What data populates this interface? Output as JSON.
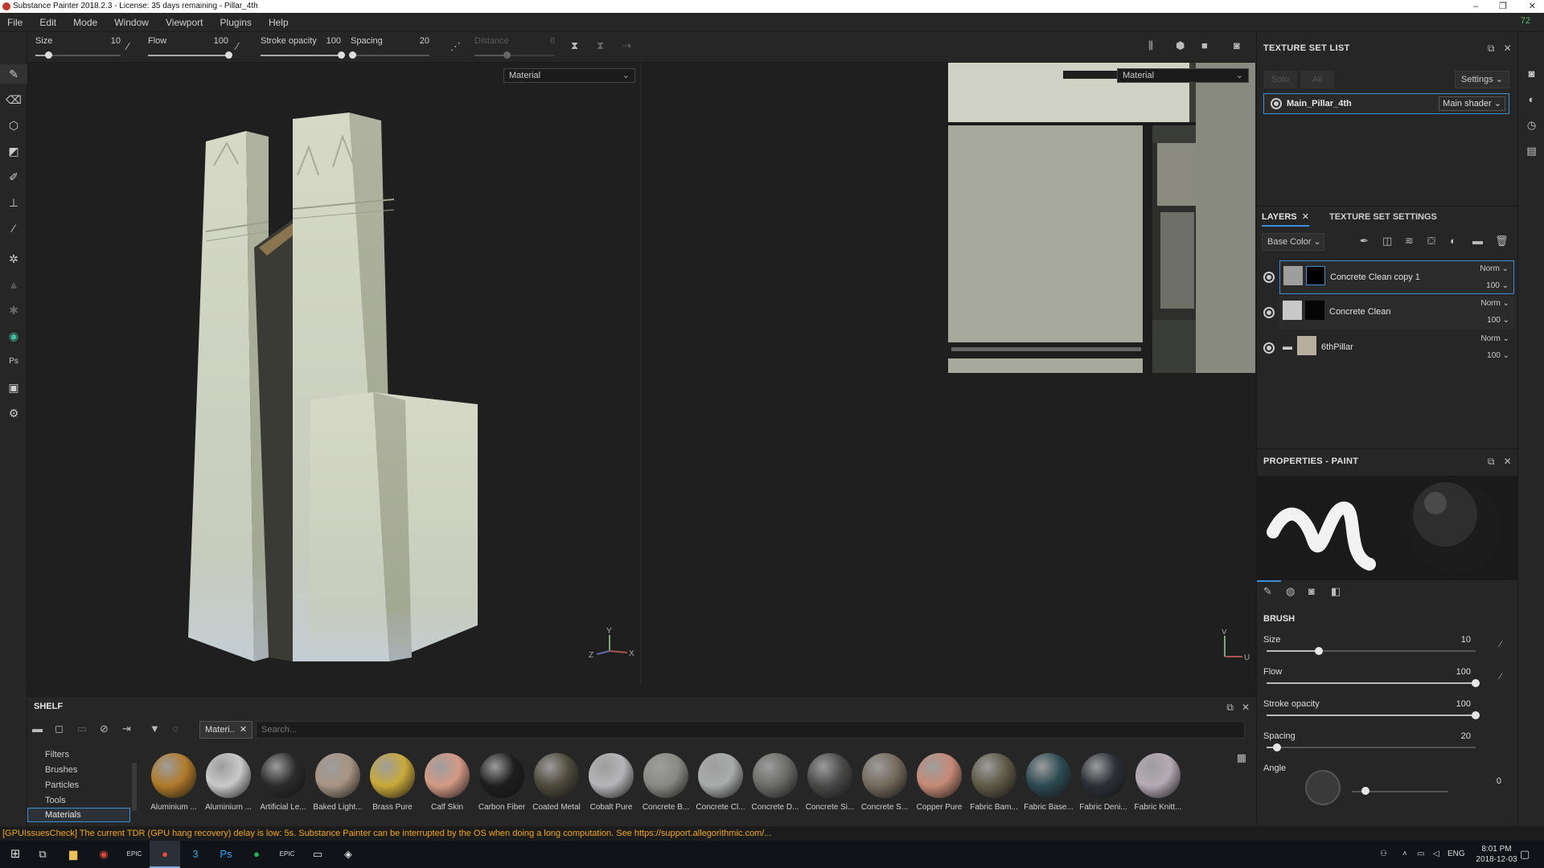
{
  "window": {
    "title": "Substance Painter 2018.2.3 - License: 35 days remaining - Pillar_4th",
    "controls": {
      "minimize": "–",
      "maximize": "❐",
      "close": "✕"
    }
  },
  "menu": {
    "items": [
      "File",
      "Edit",
      "Mode",
      "Window",
      "Viewport",
      "Plugins",
      "Help"
    ],
    "fps": "72"
  },
  "toolbar": {
    "size": {
      "label": "Size",
      "value": "10",
      "fraction": 0.15
    },
    "flow": {
      "label": "Flow",
      "value": "100",
      "fraction": 1.0
    },
    "stroke_opacity": {
      "label": "Stroke opacity",
      "value": "100",
      "fraction": 1.0
    },
    "spacing": {
      "label": "Spacing",
      "value": "20",
      "fraction": 0.02
    },
    "distance": {
      "label": "Distance",
      "value": "8",
      "fraction": 0.4
    }
  },
  "viewport3d": {
    "mode": "Material"
  },
  "viewport2d": {
    "mode": "Material"
  },
  "texture_set_list": {
    "title": "TEXTURE SET LIST",
    "solo_label": "Solo",
    "all_label": "All",
    "settings_label": "Settings",
    "set_name": "Main_Pillar_4th",
    "shader": "Main shader"
  },
  "layers": {
    "tab_layers": "LAYERS",
    "tab_texture_set_settings": "TEXTURE SET SETTINGS",
    "channel": "Base Color",
    "items": [
      {
        "name": "Concrete Clean copy 1",
        "blend": "Norm",
        "opacity": "100"
      },
      {
        "name": "Concrete Clean",
        "blend": "Norm",
        "opacity": "100"
      },
      {
        "name": "6thPillar",
        "blend": "Norm",
        "opacity": "100"
      }
    ]
  },
  "properties": {
    "title": "PROPERTIES - PAINT",
    "section": "BRUSH",
    "size": {
      "label": "Size",
      "value": "10",
      "fraction": 0.25
    },
    "flow": {
      "label": "Flow",
      "value": "100",
      "fraction": 1.0
    },
    "stroke_opacity": {
      "label": "Stroke opacity",
      "value": "100",
      "fraction": 1.0
    },
    "spacing": {
      "label": "Spacing",
      "value": "20",
      "fraction": 0.05
    },
    "angle": {
      "label": "Angle",
      "value": "0"
    }
  },
  "shelf": {
    "title": "SHELF",
    "filter_tag": "Materi..",
    "search_placeholder": "Search...",
    "categories": [
      "Filters",
      "Brushes",
      "Particles",
      "Tools",
      "Materials"
    ],
    "materials": [
      {
        "label": "Aluminium ...",
        "color": "#b07a2a"
      },
      {
        "label": "Aluminium ...",
        "color": "#c9c9c9"
      },
      {
        "label": "Artificial Le...",
        "color": "#2b2b2b"
      },
      {
        "label": "Baked Light...",
        "color": "#a89483"
      },
      {
        "label": "Brass Pure",
        "color": "#c9a93a"
      },
      {
        "label": "Calf Skin",
        "color": "#d49a86"
      },
      {
        "label": "Carbon Fiber",
        "color": "#1e1e1e"
      },
      {
        "label": "Coated Metal",
        "color": "#4d4a3c"
      },
      {
        "label": "Cobalt Pure",
        "color": "#b5b5b8"
      },
      {
        "label": "Concrete B...",
        "color": "#8a8a85"
      },
      {
        "label": "Concrete Cl...",
        "color": "#a9acab"
      },
      {
        "label": "Concrete D...",
        "color": "#6b6b69"
      },
      {
        "label": "Concrete Si...",
        "color": "#4a4a49"
      },
      {
        "label": "Concrete S...",
        "color": "#756a5c"
      },
      {
        "label": "Copper Pure",
        "color": "#c58a76"
      },
      {
        "label": "Fabric Bam...",
        "color": "#5e5a47"
      },
      {
        "label": "Fabric Base...",
        "color": "#2d4a52"
      },
      {
        "label": "Fabric Deni...",
        "color": "#2c3036"
      },
      {
        "label": "Fabric Knitt...",
        "color": "#b6abb4"
      }
    ]
  },
  "status": {
    "message": "[GPUIssuesCheck] The current TDR (GPU hang recovery) delay is low: 5s. Substance Painter can be interrupted by the OS when doing a long computation. See https://support.allegorithmic.com/..."
  },
  "taskbar": {
    "apps": [
      {
        "icon": "file-explorer-icon",
        "glyph": "▆",
        "color": "#e8c15a"
      },
      {
        "icon": "chrome-icon",
        "glyph": "◉",
        "color": "#d94b3b"
      },
      {
        "icon": "epic-games-icon",
        "glyph": "EPIC",
        "color": "#dddddd"
      },
      {
        "icon": "substance-painter-icon",
        "glyph": "●",
        "color": "#e74c3c"
      },
      {
        "icon": "app-3-icon",
        "glyph": "3",
        "color": "#2fa6d8"
      },
      {
        "icon": "photoshop-icon",
        "glyph": "Ps",
        "color": "#31a8ff"
      },
      {
        "icon": "spotify-icon",
        "glyph": "●",
        "color": "#1db954"
      },
      {
        "icon": "epic-games-icon",
        "glyph": "EPIC",
        "color": "#dddddd"
      },
      {
        "icon": "window-app-icon",
        "glyph": "▭",
        "color": "#dddddd"
      },
      {
        "icon": "unreal-engine-icon",
        "glyph": "◈",
        "color": "#dddddd"
      }
    ],
    "language": "ENG",
    "time": "8:01 PM",
    "date": "2018-12-03"
  }
}
